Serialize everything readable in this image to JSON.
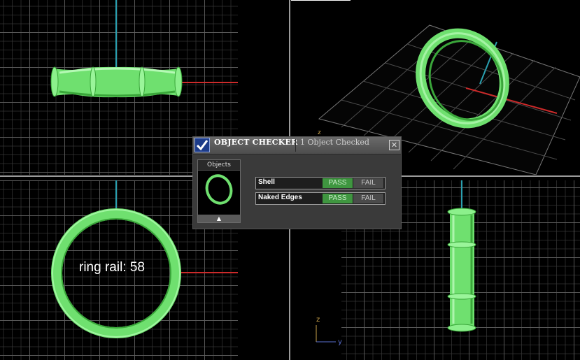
{
  "dialog": {
    "title": "OBJECT CHECKER",
    "count_text": "1  Object Checked",
    "close_glyph": "✕",
    "objects_header": "Objects",
    "scroll_up_glyph": "▲",
    "rows": [
      {
        "label": "Shell",
        "pass": "PASS",
        "fail": "FAIL"
      },
      {
        "label": "Naked Edges",
        "pass": "PASS",
        "fail": "FAIL"
      }
    ],
    "status_colors": {
      "pass": "#3f9640",
      "fail": "#4a4a4a"
    }
  },
  "overlay_text": "ring rail: 58",
  "axes": {
    "z_label": "z",
    "y_label": "y"
  },
  "colors": {
    "model": "#7cf07c",
    "x_axis": "#cc2a2a",
    "y_axis": "#2aa0b0",
    "grid": "#5f5f5f"
  },
  "icons": [
    "checkmark-icon",
    "close-icon",
    "scroll-up-icon"
  ]
}
